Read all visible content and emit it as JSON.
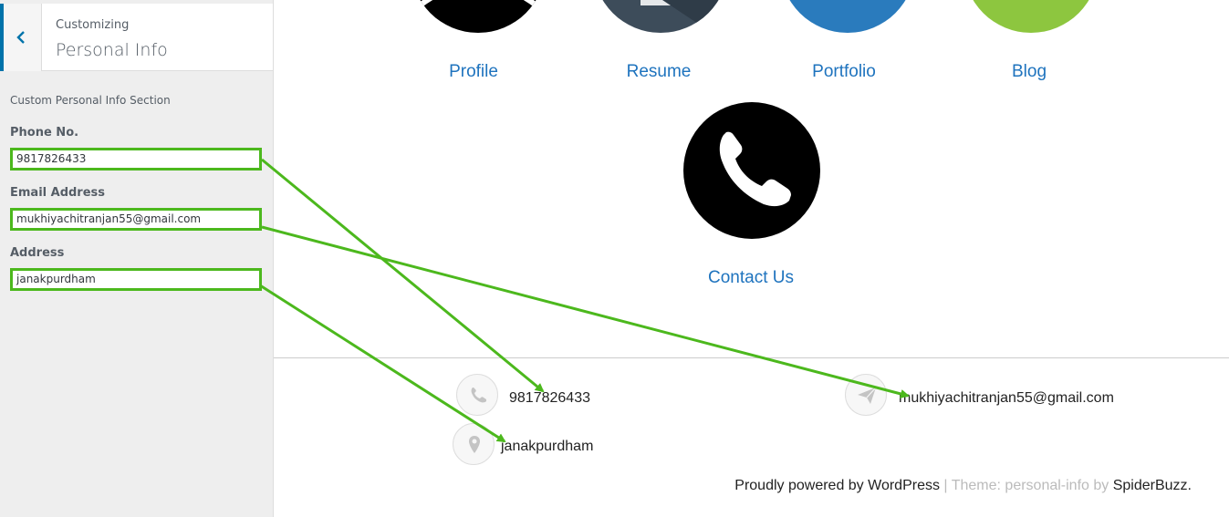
{
  "sidebar": {
    "customizing_label": "Customizing",
    "panel_title": "Personal Info",
    "section_title": "Custom Personal Info Section",
    "fields": {
      "phone": {
        "label": "Phone No.",
        "value": "9817826433"
      },
      "email": {
        "label": "Email Address",
        "value": "mukhiyachitranjan55@gmail.com"
      },
      "address": {
        "label": "Address",
        "value": "janakpurdham"
      }
    }
  },
  "preview": {
    "nav": [
      "Profile",
      "Resume",
      "Portfolio",
      "Blog"
    ],
    "contact_label": "Contact Us",
    "footer_info": {
      "phone": "9817826433",
      "email": "mukhiyachitranjan55@gmail.com",
      "address": "janakpurdham"
    },
    "credits": {
      "powered": "Proudly powered by WordPress",
      "separator": " | ",
      "theme_prefix": "Theme: personal-info by ",
      "author": "SpiderBuzz",
      "period": "."
    }
  },
  "colors": {
    "accent": "#0073aa",
    "link": "#1e73be",
    "annotation": "#4cb81d",
    "portfolio_circle": "#2a7bbd",
    "blog_circle": "#8dc63f",
    "resume_circle": "#3d4c5a"
  },
  "icons": [
    "chevron-left-icon",
    "phone-icon",
    "paper-plane-icon",
    "map-pin-icon"
  ]
}
